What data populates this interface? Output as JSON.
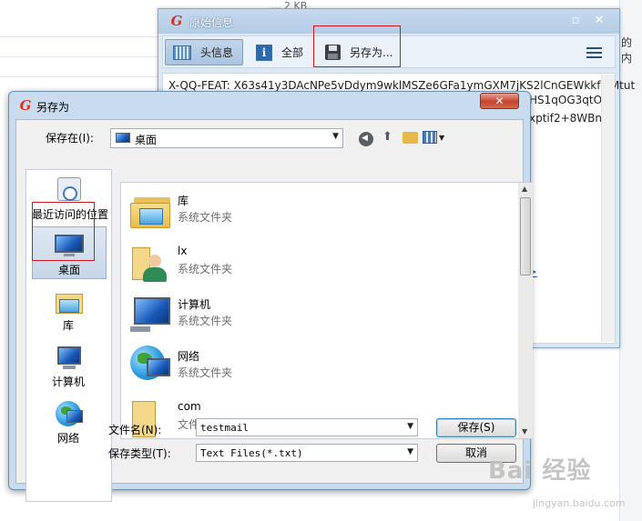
{
  "background": {
    "top_fragment": "... 2 KB",
    "right_fragment": "的内"
  },
  "info_window": {
    "title": "原始信息",
    "toolbar": {
      "headers_label": "头信息",
      "all_label": "全部",
      "saveas_label": "另存为..."
    },
    "header_line_1": "X-QQ-FEAT: X63s41y3DAcNPe5vDdym9wklMSZe6GFa1ymGXM7jKS2lCnGEWkkfMMtut",
    "line_2_fragment": "HS1qOG3qtOJ",
    "line_3_fragment": "xptif2+8WBnrR",
    "link_fragment": "n>"
  },
  "save_dialog": {
    "title": "另存为",
    "close_glyph": "✕",
    "save_in_label": "保存在(I):",
    "location": "桌面",
    "places": [
      {
        "name": "recent",
        "label": "最近访问的位置"
      },
      {
        "name": "desktop",
        "label": "桌面"
      },
      {
        "name": "libraries",
        "label": "库"
      },
      {
        "name": "computer",
        "label": "计算机"
      },
      {
        "name": "network",
        "label": "网络"
      }
    ],
    "files": [
      {
        "name": "库",
        "type": "系统文件夹",
        "icon": "library-folder-icon"
      },
      {
        "name": "lx",
        "type": "系统文件夹",
        "icon": "user-folder-icon"
      },
      {
        "name": "计算机",
        "type": "系统文件夹",
        "icon": "computer-icon"
      },
      {
        "name": "网络",
        "type": "系统文件夹",
        "icon": "network-icon"
      },
      {
        "name": "com",
        "type": "文件夹",
        "icon": "folder-icon"
      }
    ],
    "filename_label": "文件名(N):",
    "filename_value": "testmail",
    "filetype_label": "保存类型(T):",
    "filetype_value": "Text Files(*.txt)",
    "save_button": "保存(S)",
    "cancel_button": "取消"
  },
  "watermark": {
    "main": "Bai 经验",
    "sub": "jingyan.baidu.com"
  },
  "colors": {
    "highlight": "#d2181e",
    "titlebar": "#b3cbe4",
    "dialog_frame": "#c8dbef"
  }
}
